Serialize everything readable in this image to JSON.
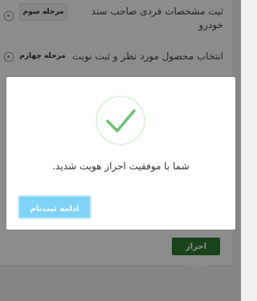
{
  "steps": [
    {
      "badge": "مرحله سوم",
      "text": "ثبت مشخصات فردی صاحب سند خودرو"
    },
    {
      "badge": "مرحله چهارم",
      "text": "انتخاب محصول مورد نظر و ثبت نوبت"
    }
  ],
  "identity_button_label": "احراز هویت",
  "modal": {
    "message": "شما با موفقیت احراز هویت شدید.",
    "continue_label": "ادامه ثبت‌نام"
  },
  "colors": {
    "success_green": "#6cc070",
    "continue_blue": "#7fd3f7",
    "verify_green": "#2e7d32"
  },
  "icons": [
    "lock-icon",
    "check-icon"
  ]
}
